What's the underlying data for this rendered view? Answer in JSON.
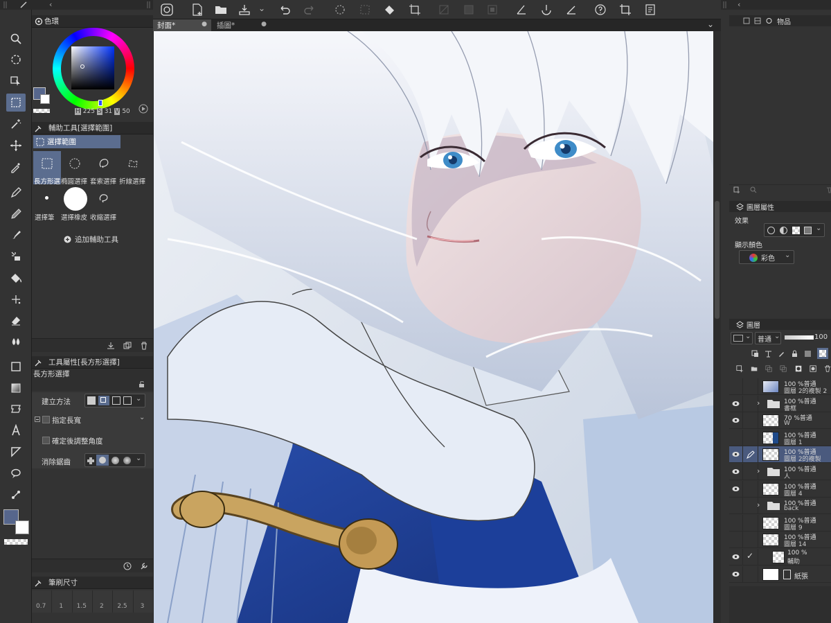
{
  "colors": {
    "accent": "#5b6d8f",
    "panel": "#333333",
    "panel_dark": "#2a2a2a",
    "canvas_hair": "#e8eaf0",
    "cape_blue": "#1c3f9a"
  },
  "color_panel": {
    "title": "色環",
    "h": "225",
    "s": "31",
    "v": "50",
    "h_label": "H",
    "s_label": "S",
    "v_label": "V"
  },
  "sub_tool_panel": {
    "title": "輔助工具[選擇範圍]",
    "group": "選擇範圍",
    "tools": [
      "長方形選",
      "橢圓選擇",
      "套索選擇",
      "折線選擇",
      "選擇筆",
      "選擇橡皮",
      "收縮選擇"
    ],
    "add_label": "追加輔助工具"
  },
  "tool_property": {
    "title": "工具屬性[長方形選擇]",
    "tool_name": "長方形選擇",
    "create_method": "建立方法",
    "aspect": "指定長寬",
    "rotate_after": "確定後調整角度",
    "antialias": "消除鋸齒"
  },
  "brush_size": {
    "title": "筆刷尺寸",
    "values": [
      "0.7",
      "1",
      "1.5",
      "2",
      "2.5",
      "3"
    ]
  },
  "tabs": [
    {
      "label": "封面*"
    },
    {
      "label": "插圖*"
    }
  ],
  "right_top": {
    "tab_label": "物品"
  },
  "layer_property": {
    "title": "圖層屬性",
    "effect": "效果",
    "display_color": "顯示顏色",
    "color_mode": "彩色"
  },
  "layers_panel": {
    "title": "圖層",
    "blend": "普通",
    "opacity": "100",
    "layers": [
      {
        "l1": "100 %普通",
        "l2": "圖層 2的複製 2",
        "eye": false,
        "thumb": "art"
      },
      {
        "l1": "100 %普通",
        "l2": "書框",
        "eye": true,
        "thumb": "folder"
      },
      {
        "l1": "70 %普通",
        "l2": "W",
        "eye": true,
        "thumb": "checker"
      },
      {
        "l1": "100 %普通",
        "l2": "圖層 1",
        "eye": false,
        "thumb": "blue"
      },
      {
        "l1": "100 %普通",
        "l2": "圖層 2的複製",
        "eye": true,
        "thumb": "checker",
        "selected": true
      },
      {
        "l1": "100 %普通",
        "l2": "人",
        "eye": true,
        "thumb": "folder"
      },
      {
        "l1": "100 %普通",
        "l2": "圖層 4",
        "eye": true,
        "thumb": "checker"
      },
      {
        "l1": "100 %普通",
        "l2": "back",
        "eye": false,
        "thumb": "folder"
      },
      {
        "l1": "100 %普通",
        "l2": "圖層 9",
        "eye": false,
        "thumb": "checker"
      },
      {
        "l1": "100 %普通",
        "l2": "圖層 14",
        "eye": false,
        "thumb": "checker"
      },
      {
        "l1": "100 %",
        "l2": "輔助",
        "eye": true,
        "thumb": "checker"
      },
      {
        "l1": "紙張",
        "l2": "",
        "eye": true,
        "thumb": "white"
      }
    ]
  }
}
